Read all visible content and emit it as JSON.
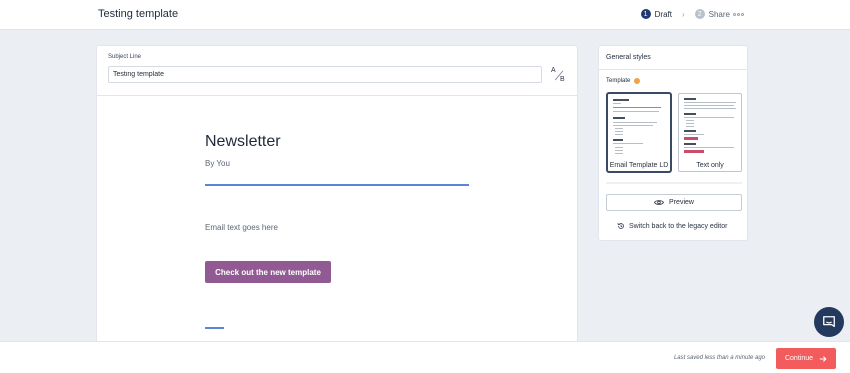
{
  "header": {
    "title": "Testing template",
    "steps": [
      {
        "number": "1",
        "label": "Draft"
      },
      {
        "number": "2",
        "label": "Share"
      }
    ],
    "separator": "›"
  },
  "editor": {
    "subject_label": "Subject Line",
    "subject_value": "Testing template",
    "ab_a": "A",
    "ab_b": "B",
    "newsletter_title": "Newsletter",
    "byline": "By You",
    "body_text": "Email text goes here",
    "cta_label": "Check out the new template"
  },
  "styles_panel": {
    "header": "General styles",
    "template_label": "Template",
    "templates": [
      {
        "caption": "Email Template LD",
        "selected": true
      },
      {
        "caption": "Text only",
        "selected": false
      }
    ],
    "preview_label": "Preview",
    "legacy_label": "Switch back to the legacy editor"
  },
  "footer": {
    "saved_text": "Last saved less than a minute ago",
    "continue_label": "Continue"
  },
  "colors": {
    "accent_blue": "#5a86d6",
    "cta_purple": "#925a93",
    "continue_red": "#f25c5c",
    "step_active": "#233a70",
    "template_dot": "#f0a24b"
  }
}
